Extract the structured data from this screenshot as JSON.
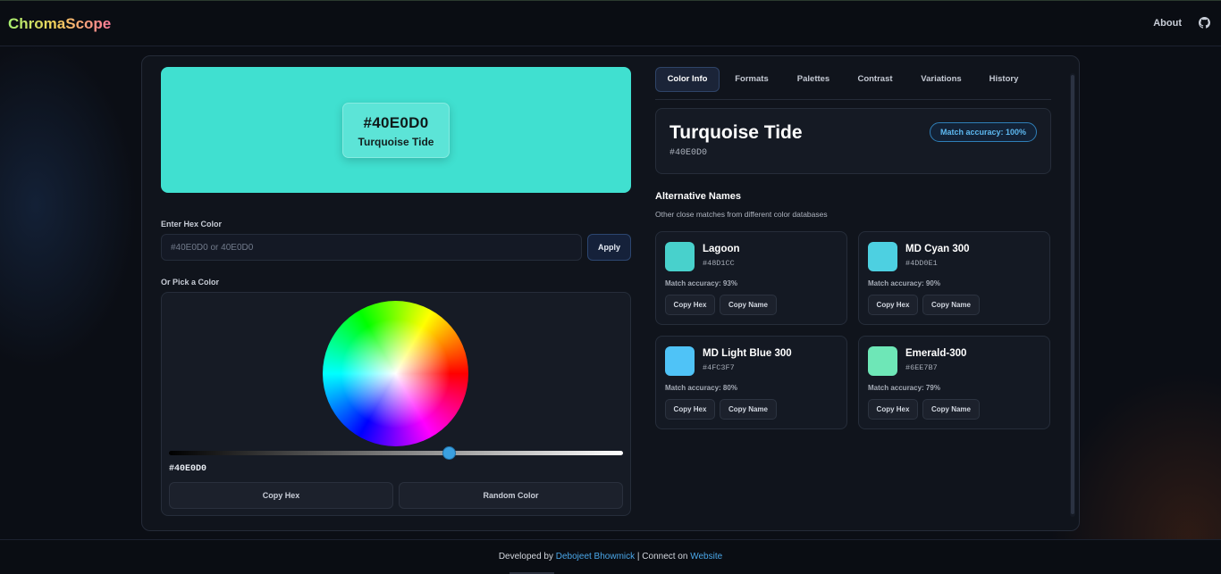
{
  "header": {
    "logo": "ChromaScope",
    "about": "About",
    "github_icon": "github-icon"
  },
  "colors": {
    "current": "#40E0D0",
    "accent": "#4aa6e8"
  },
  "preview": {
    "hex": "#40E0D0",
    "name": "Turquoise Tide"
  },
  "hex_input": {
    "label": "Enter Hex Color",
    "placeholder": "#40E0D0 or 40E0D0",
    "value": "",
    "apply": "Apply"
  },
  "picker": {
    "label": "Or Pick a Color",
    "hex": "#40E0D0",
    "brightness": 0.62,
    "copy_hex": "Copy Hex",
    "random": "Random Color"
  },
  "tabs": [
    {
      "label": "Color Info",
      "active": true
    },
    {
      "label": "Formats",
      "active": false
    },
    {
      "label": "Palettes",
      "active": false
    },
    {
      "label": "Contrast",
      "active": false
    },
    {
      "label": "Variations",
      "active": false
    },
    {
      "label": "History",
      "active": false
    }
  ],
  "color_info": {
    "name": "Turquoise Tide",
    "hex": "#40E0D0",
    "accuracy": "Match accuracy: 100%"
  },
  "alternatives": {
    "title": "Alternative Names",
    "subtitle": "Other close matches from different color databases",
    "items": [
      {
        "name": "Lagoon",
        "hex": "#48D1CC",
        "accuracy": "Match accuracy: 93%",
        "color": "#48D1CC",
        "copy_hex": "Copy Hex",
        "copy_name": "Copy Name"
      },
      {
        "name": "MD Cyan 300",
        "hex": "#4DD0E1",
        "accuracy": "Match accuracy: 90%",
        "color": "#4DD0E1",
        "copy_hex": "Copy Hex",
        "copy_name": "Copy Name"
      },
      {
        "name": "MD Light Blue 300",
        "hex": "#4FC3F7",
        "accuracy": "Match accuracy: 80%",
        "color": "#4FC3F7",
        "copy_hex": "Copy Hex",
        "copy_name": "Copy Name"
      },
      {
        "name": "Emerald-300",
        "hex": "#6EE7B7",
        "accuracy": "Match accuracy: 79%",
        "color": "#6EE7B7",
        "copy_hex": "Copy Hex",
        "copy_name": "Copy Name"
      }
    ]
  },
  "footer": {
    "prefix": "Developed by",
    "author": "Debojeet Bhowmick",
    "separator": "| Connect on",
    "website": "Website"
  }
}
